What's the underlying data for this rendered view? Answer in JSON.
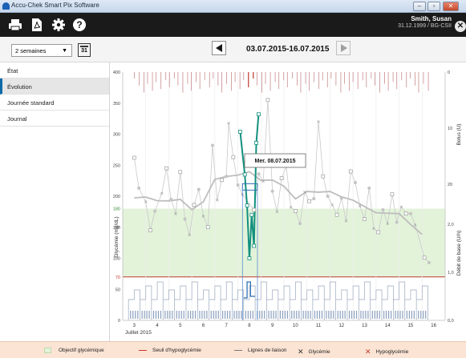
{
  "window": {
    "title": "Accu-Chek Smart Pix Software",
    "min": "–",
    "max": "▫",
    "close": "✕"
  },
  "toolbar": {
    "print_icon": "printer-icon",
    "pdf_icon": "pdf-icon",
    "settings_icon": "gear-icon",
    "help_icon": "help-icon"
  },
  "user": {
    "name": "Smith, Susan",
    "details": "31.12.1999 / BG-CSII",
    "close": "✕"
  },
  "period": {
    "select_value": "2 semaines",
    "calendar_num": "31",
    "range": "03.07.2015-16.07.2015"
  },
  "sidebar": {
    "items": [
      {
        "label": "État"
      },
      {
        "label": "Évolution"
      },
      {
        "label": "Journée standard"
      },
      {
        "label": "Journal"
      }
    ]
  },
  "chart": {
    "ylabel_left": "Glycémie (mg/dL)",
    "ylabel_right_top": "Bolus (U)",
    "ylabel_right_bottom": "Débit de base (U/h)",
    "month_label": "Juillet 2015",
    "tooltip": "Mer. 08.07.2015",
    "target_low_label": "70",
    "target_high_label": "180",
    "colors": {
      "target": "#e3f3da",
      "hypo_line": "#c0392b",
      "bg_line": "#9e9e9e",
      "highlight": "#12907e",
      "basal": "#2f6fb5"
    }
  },
  "chart_data": {
    "type": "line",
    "x_label": "Juillet 2015",
    "x_ticks": [
      "3",
      "4",
      "5",
      "6",
      "7",
      "8",
      "9",
      "10",
      "11",
      "12",
      "13",
      "14",
      "15",
      "16"
    ],
    "y_ticks_left": [
      "0",
      "50",
      "70",
      "100",
      "150",
      "180",
      "200",
      "250",
      "300",
      "350",
      "400"
    ],
    "y_ticks_right_top": [
      "0",
      "10",
      "20"
    ],
    "y_ticks_right_bottom": [
      "0,0",
      "1,0",
      "2,0"
    ],
    "ylim_left": [
      0,
      400
    ],
    "target_range": [
      70,
      180
    ],
    "hypo_threshold": 70,
    "series": [
      {
        "name": "Glycémie",
        "points": [
          [
            3.0,
            262
          ],
          [
            3.2,
            213
          ],
          [
            3.5,
            191
          ],
          [
            3.7,
            145
          ],
          [
            3.9,
            176
          ],
          [
            4.2,
            205
          ],
          [
            4.4,
            245
          ],
          [
            4.6,
            195
          ],
          [
            4.8,
            172
          ],
          [
            5.0,
            239
          ],
          [
            5.2,
            163
          ],
          [
            5.4,
            138
          ],
          [
            5.6,
            186
          ],
          [
            5.8,
            211
          ],
          [
            6.0,
            168
          ],
          [
            6.2,
            150
          ],
          [
            6.4,
            282
          ],
          [
            6.6,
            194
          ],
          [
            6.8,
            226
          ],
          [
            7.0,
            232
          ],
          [
            7.1,
            318
          ],
          [
            7.3,
            263
          ],
          [
            7.5,
            218
          ],
          [
            7.7,
            203
          ],
          [
            8.2,
            178
          ],
          [
            8.4,
            236
          ],
          [
            8.6,
            224
          ],
          [
            8.8,
            355
          ],
          [
            9.0,
            208
          ],
          [
            9.2,
            175
          ],
          [
            9.4,
            229
          ],
          [
            9.6,
            248
          ],
          [
            9.8,
            182
          ],
          [
            10.0,
            176
          ],
          [
            10.2,
            156
          ],
          [
            10.4,
            207
          ],
          [
            10.6,
            192
          ],
          [
            10.8,
            196
          ],
          [
            11.0,
            320
          ],
          [
            11.2,
            232
          ],
          [
            11.4,
            200
          ],
          [
            11.6,
            186
          ],
          [
            11.8,
            170
          ],
          [
            12.0,
            197
          ],
          [
            12.2,
            160
          ],
          [
            12.4,
            240
          ],
          [
            12.6,
            222
          ],
          [
            12.8,
            184
          ],
          [
            13.0,
            163
          ],
          [
            13.2,
            213
          ],
          [
            13.4,
            148
          ],
          [
            13.6,
            142
          ],
          [
            13.8,
            178
          ],
          [
            14.0,
            156
          ],
          [
            14.2,
            203
          ],
          [
            14.4,
            158
          ],
          [
            14.6,
            183
          ],
          [
            14.8,
            172
          ],
          [
            15.0,
            172
          ],
          [
            15.2,
            154
          ],
          [
            15.6,
            101
          ],
          [
            15.8,
            93
          ]
        ]
      },
      {
        "name": "08.07.2015",
        "points": [
          [
            7.6,
            304
          ],
          [
            7.8,
            235
          ],
          [
            7.9,
            185
          ],
          [
            8.0,
            100
          ],
          [
            8.1,
            170
          ],
          [
            8.2,
            120
          ],
          [
            8.3,
            286
          ],
          [
            8.4,
            332
          ]
        ]
      }
    ],
    "legend": [
      "Objectif glycémique",
      "Seuil d'hypoglycémie",
      "Lignes de liaison",
      "Glycémie",
      "Hypoglycémie"
    ]
  },
  "legend": {
    "target": "Objectif glycémique",
    "hypo_threshold": "Seuil d'hypoglycémie",
    "connection_lines": "Lignes de liaison",
    "glycemia": "Glycémie",
    "hypoglycemia": "Hypoglycémie"
  }
}
